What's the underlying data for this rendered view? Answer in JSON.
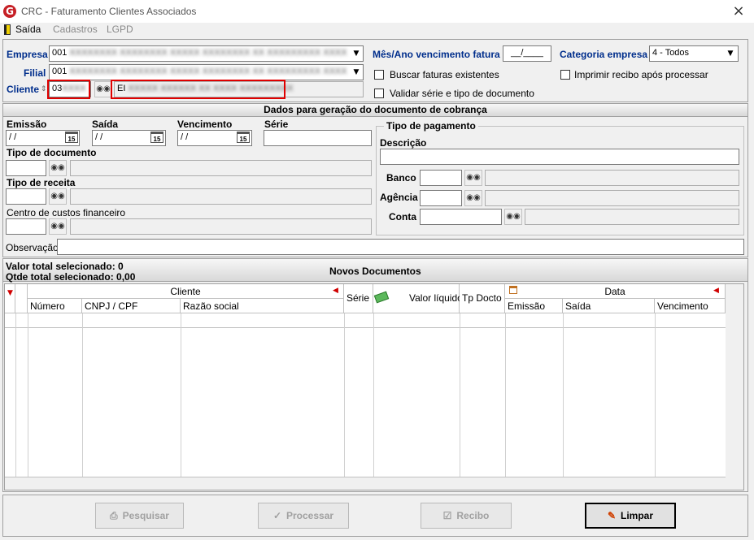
{
  "window": {
    "title": "CRC - Faturamento Clientes Associados"
  },
  "menu": {
    "items": [
      "Saída",
      "Cadastros",
      "LGPD"
    ]
  },
  "header": {
    "empresa_label": "Empresa",
    "empresa_code": "001",
    "empresa_name": "XXXXXXXX XXXXXXXX XXXXX XXXXXXXX XX XXXXXXXXX XXXX",
    "filial_label": "Filial",
    "filial_code": "001",
    "filial_name": "XXXXXXXX XXXXXXXX XXXXX XXXXXXXX XX XXXXXXXXX XXXX",
    "cliente_label": "Cliente",
    "cliente_code": "03",
    "cliente_code_hidden": "XXXX",
    "cliente_name": "XXXXX XXXXXX XX XXXX XXXXXXXXX",
    "cliente_name_prefix": "EI",
    "mes_ano_label": "Mês/Ano vencimento fatura",
    "mes_ano_value": "__/____",
    "categoria_label": "Categoria empresa",
    "categoria_value": "4 - Todos",
    "buscar_label": "Buscar faturas existentes",
    "validar_label": "Validar série e tipo de documento",
    "imprimir_label": "Imprimir recibo após processar"
  },
  "dados": {
    "section_title": "Dados para geração do documento de cobrança",
    "emissao_label": "Emissão",
    "emissao_value": "/ /",
    "saida_label": "Saída",
    "saida_value": "/ /",
    "vencimento_label": "Vencimento",
    "vencimento_value": "/ /",
    "serie_label": "Série",
    "tipo_doc_label": "Tipo de documento",
    "tipo_receita_label": "Tipo de receita",
    "centro_custos_label": "Centro de custos financeiro",
    "observacao_label": "Observação",
    "cal_text": "15"
  },
  "pagamento": {
    "group_title": "Tipo de pagamento",
    "descricao_label": "Descrição",
    "banco_label": "Banco",
    "agencia_label": "Agência",
    "conta_label": "Conta"
  },
  "novos": {
    "valor_total": "Valor total selecionado: 0",
    "qtde_total": "Qtde total selecionado: 0,00",
    "section_title": "Novos Documentos",
    "cliente_group": "Cliente",
    "data_group": "Data",
    "columns": {
      "numero": "Número",
      "cnpj": "CNPJ / CPF",
      "razao": "Razão social",
      "serie": "Série",
      "valor": "Valor líquido",
      "tp_docto": "Tp Docto",
      "emissao": "Emissão",
      "saida": "Saída",
      "vencimento": "Vencimento"
    }
  },
  "buttons": {
    "pesquisar": "Pesquisar",
    "processar": "Processar",
    "recibo": "Recibo",
    "limpar": "Limpar"
  },
  "colors": {
    "label_blue": "#002e8c",
    "highlight_red": "#e00000",
    "brand_red": "#c62026"
  }
}
